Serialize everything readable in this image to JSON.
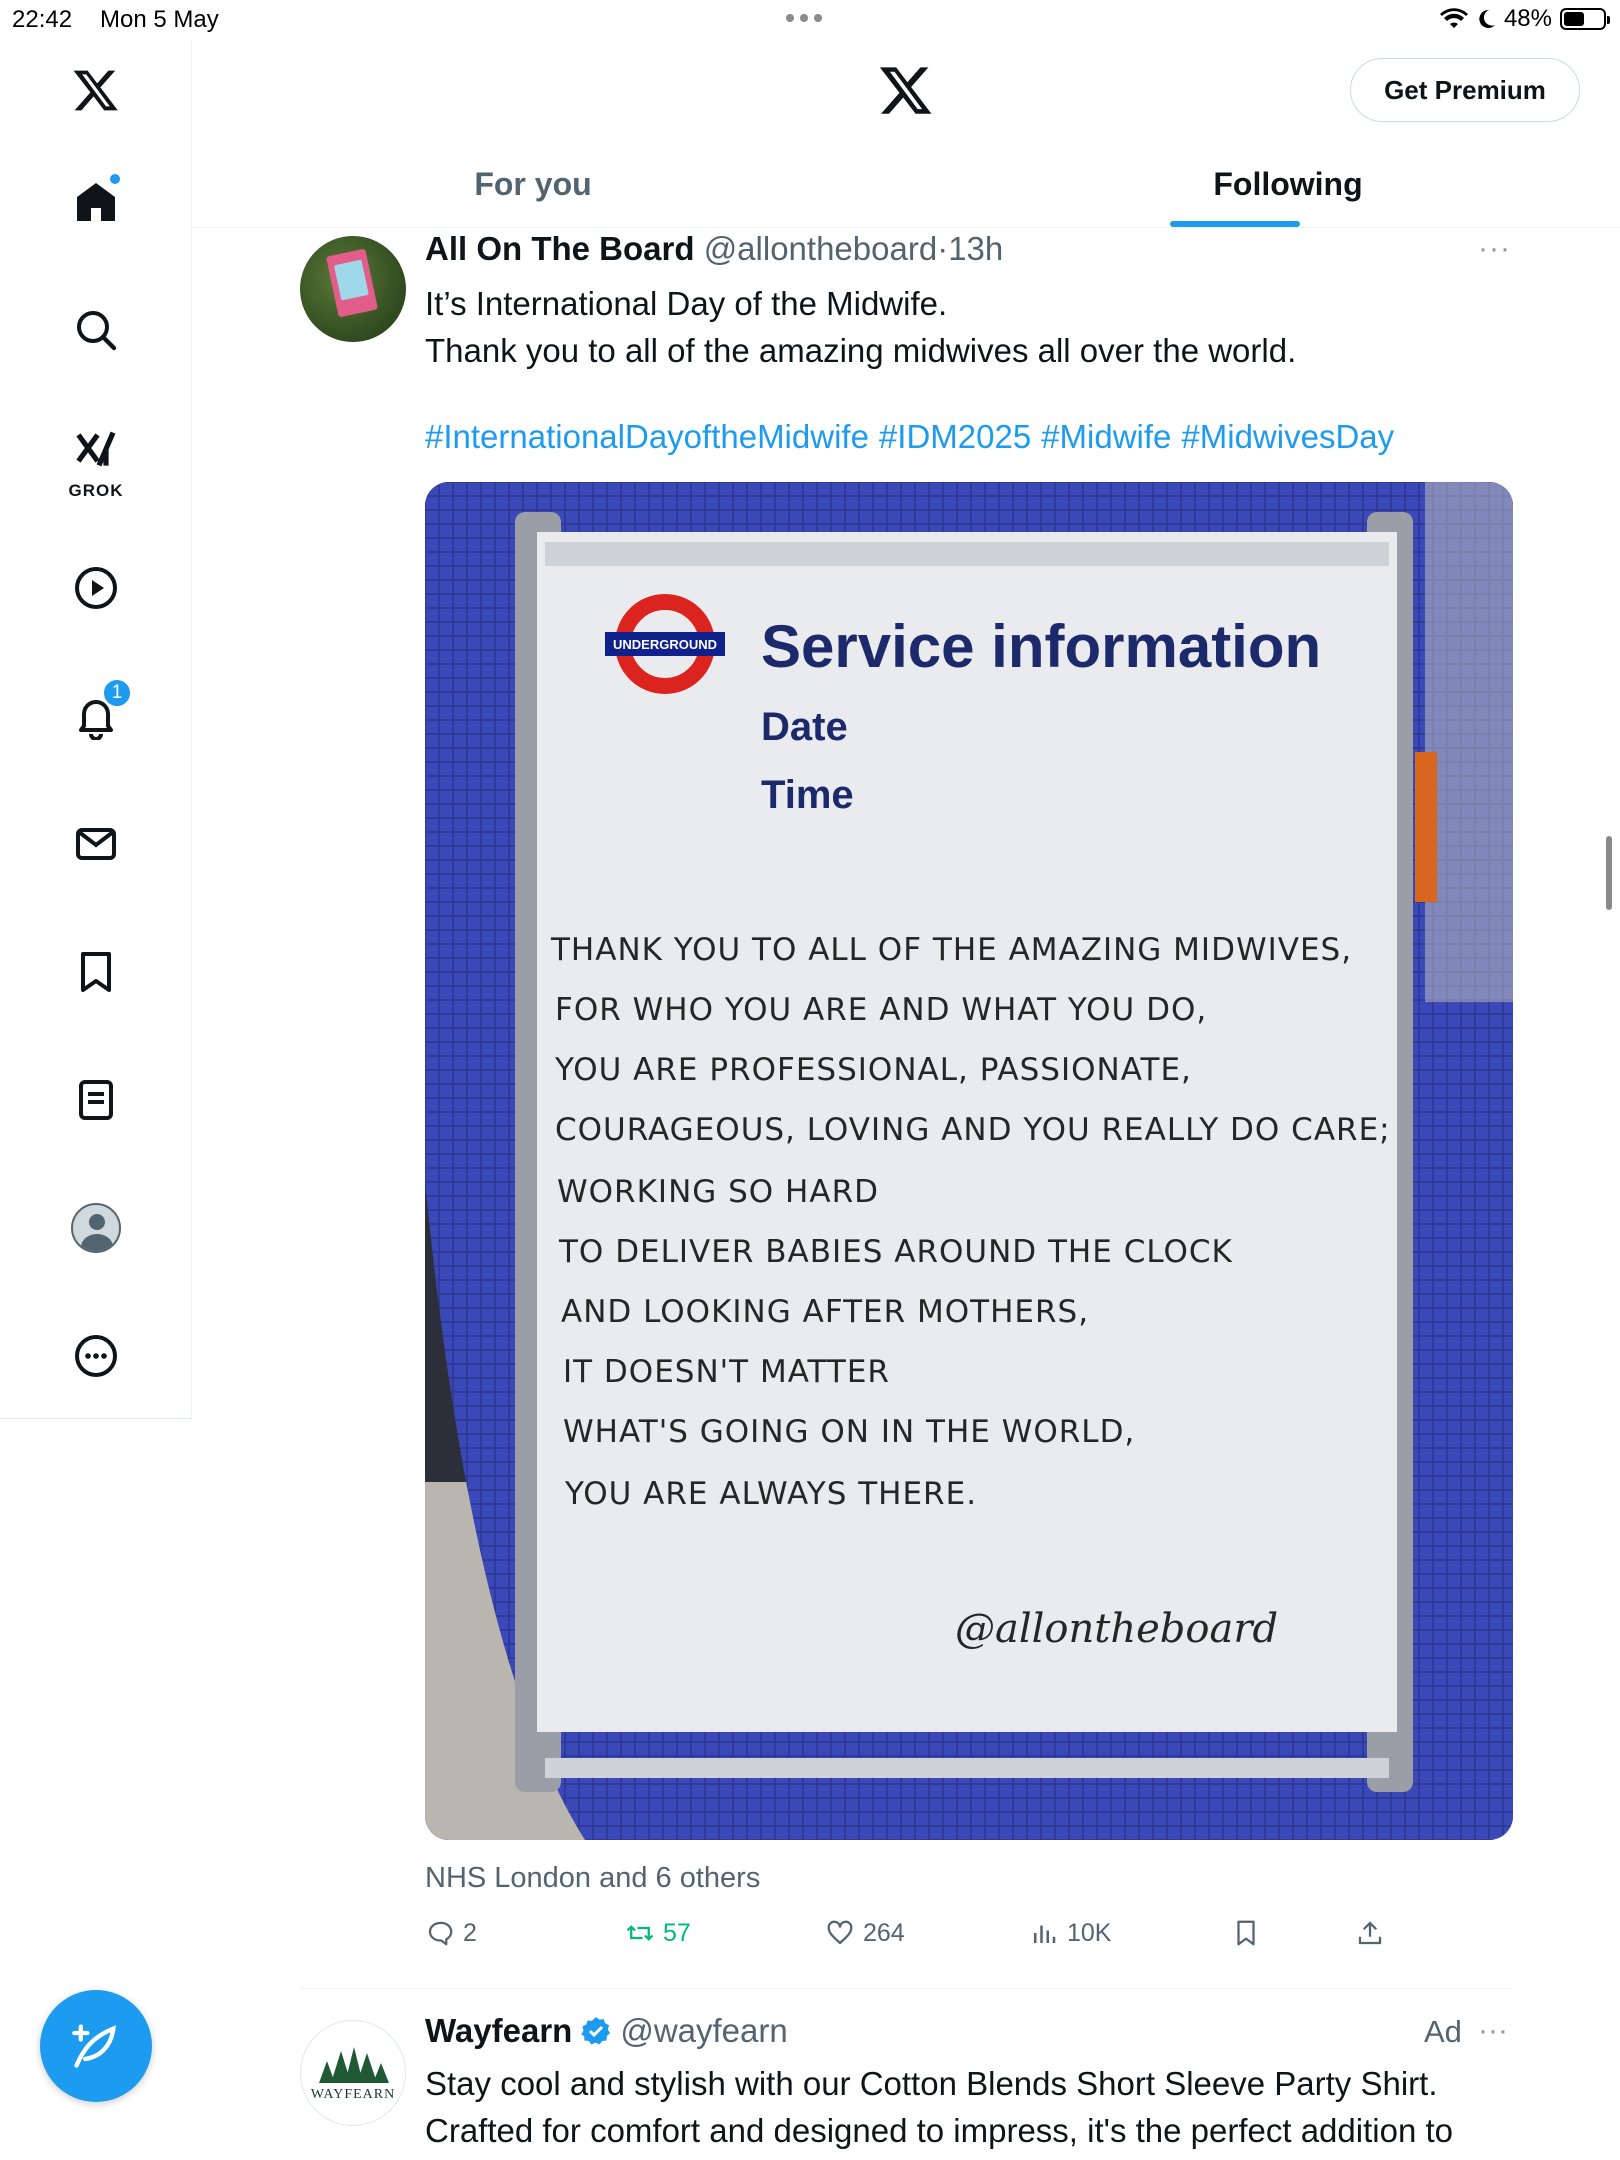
{
  "status_bar": {
    "time": "22:42",
    "date": "Mon 5 May",
    "battery": "48%"
  },
  "header": {
    "premium_label": "Get Premium"
  },
  "tabs": [
    {
      "label": "For you"
    },
    {
      "label": "Following"
    }
  ],
  "sidebar": {
    "grok_label": "GROK",
    "notification_count": "1"
  },
  "tweet": {
    "name": "All On The Board",
    "handle": "@allontheboard",
    "sep": "·",
    "time": "13h",
    "more": "···",
    "text_lines": [
      "It’s International Day of the Midwife.",
      "Thank you to all of the amazing midwives all over the world."
    ],
    "hashtags": [
      "#InternationalDayoftheMidwife",
      "#IDM2025",
      "#Midwife",
      "#MidwivesDay"
    ],
    "image": {
      "roundel_text": "UNDERGROUND",
      "heading": "Service information",
      "date_label": "Date",
      "time_label": "Time",
      "poem_lines": [
        "THANK YOU TO ALL OF THE AMAZING MIDWIVES,",
        "FOR WHO YOU ARE AND WHAT YOU DO,",
        "YOU ARE PROFESSIONAL, PASSIONATE,",
        "COURAGEOUS, LOVING AND YOU REALLY DO CARE;",
        "WORKING SO HARD",
        "TO DELIVER BABIES AROUND THE CLOCK",
        "AND LOOKING AFTER MOTHERS,",
        "IT DOESN'T MATTER",
        "WHAT'S GOING ON IN THE WORLD,",
        "YOU ARE ALWAYS THERE."
      ],
      "signature": "@allontheboard"
    },
    "social_context": "NHS London and 6 others",
    "actions": {
      "replies": "2",
      "reposts": "57",
      "likes": "264",
      "views": "10K"
    }
  },
  "ad": {
    "name": "Wayfearn",
    "handle": "@wayfearn",
    "label": "Ad",
    "more": "···",
    "logo_text": "WAYFEARN",
    "text_lines": [
      "Stay cool and stylish with our Cotton Blends Short Sleeve Party Shirt.",
      "Crafted for comfort and designed to impress, it's the perfect addition to"
    ]
  },
  "colors": {
    "accent": "#1d9bf0",
    "repost": "#00ba7c",
    "muted": "#536471"
  }
}
